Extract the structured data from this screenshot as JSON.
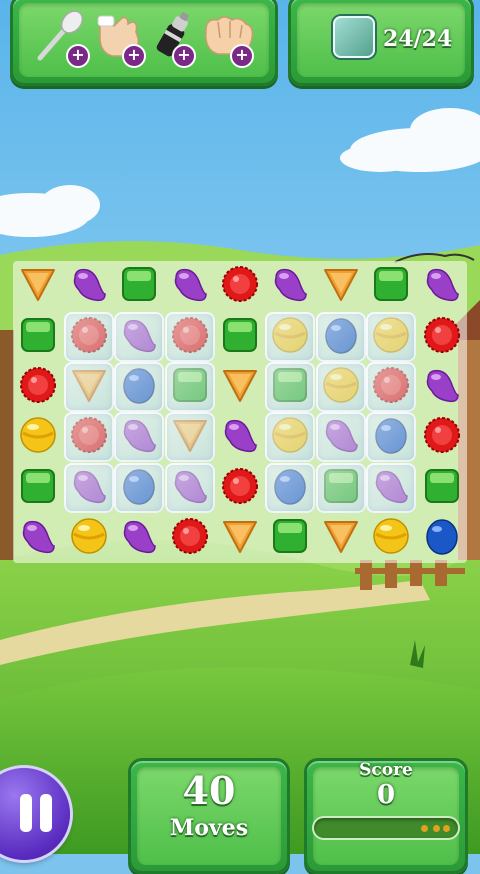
{
  "top_bar": {
    "boosters": [
      {
        "icon": "spoon-icon",
        "plus": "+"
      },
      {
        "icon": "hand-icon",
        "plus": "+"
      },
      {
        "icon": "shaker-icon",
        "plus": "+"
      },
      {
        "icon": "fist-icon",
        "plus": "+"
      }
    ],
    "goal": {
      "icon": "ice-block-icon",
      "counter": "24/24"
    }
  },
  "board": {
    "columns": 9,
    "rows": 6,
    "grid": [
      [
        [
          "orange-triangle",
          0
        ],
        [
          "purple-bean",
          0
        ],
        [
          "green-square",
          0
        ],
        [
          "purple-bean",
          0
        ],
        [
          "red-round",
          0
        ],
        [
          "purple-bean",
          0
        ],
        [
          "orange-triangle",
          0
        ],
        [
          "green-square",
          0
        ],
        [
          "purple-bean",
          0
        ]
      ],
      [
        [
          "green-square",
          0
        ],
        [
          "red-round",
          1
        ],
        [
          "purple-bean",
          1
        ],
        [
          "red-round",
          1
        ],
        [
          "green-square",
          0
        ],
        [
          "yellow-ball",
          1
        ],
        [
          "blue-ball",
          1
        ],
        [
          "yellow-ball",
          1
        ],
        [
          "red-round",
          0
        ]
      ],
      [
        [
          "red-round",
          0
        ],
        [
          "orange-triangle",
          1
        ],
        [
          "blue-ball",
          1
        ],
        [
          "green-square",
          1
        ],
        [
          "orange-triangle",
          0
        ],
        [
          "green-square",
          1
        ],
        [
          "yellow-ball",
          1
        ],
        [
          "red-round",
          1
        ],
        [
          "purple-bean",
          0
        ]
      ],
      [
        [
          "yellow-ball",
          0
        ],
        [
          "red-round",
          1
        ],
        [
          "purple-bean",
          1
        ],
        [
          "orange-triangle",
          1
        ],
        [
          "purple-bean",
          0
        ],
        [
          "yellow-ball",
          1
        ],
        [
          "purple-bean",
          1
        ],
        [
          "blue-ball",
          1
        ],
        [
          "red-round",
          0
        ]
      ],
      [
        [
          "green-square",
          0
        ],
        [
          "purple-bean",
          1
        ],
        [
          "blue-ball",
          1
        ],
        [
          "purple-bean",
          1
        ],
        [
          "red-round",
          0
        ],
        [
          "blue-ball",
          1
        ],
        [
          "green-square",
          1
        ],
        [
          "purple-bean",
          1
        ],
        [
          "green-square",
          0
        ]
      ],
      [
        [
          "purple-bean",
          0
        ],
        [
          "yellow-ball",
          0
        ],
        [
          "purple-bean",
          0
        ],
        [
          "red-round",
          0
        ],
        [
          "orange-triangle",
          0
        ],
        [
          "green-square",
          0
        ],
        [
          "orange-triangle",
          0
        ],
        [
          "yellow-ball",
          0
        ],
        [
          "blue-ball",
          0
        ]
      ]
    ]
  },
  "bottom_bar": {
    "pause_icon": "pause-icon",
    "moves_value": "40",
    "moves_label": "Moves",
    "score_label": "Score",
    "score_value": "0",
    "score_progress": 0.0
  },
  "colors": {
    "panel_green": "#3bb84a",
    "sky": "#7cc4ee",
    "grass": "#6cc23a",
    "pause_purple": "#6a3ad0"
  }
}
